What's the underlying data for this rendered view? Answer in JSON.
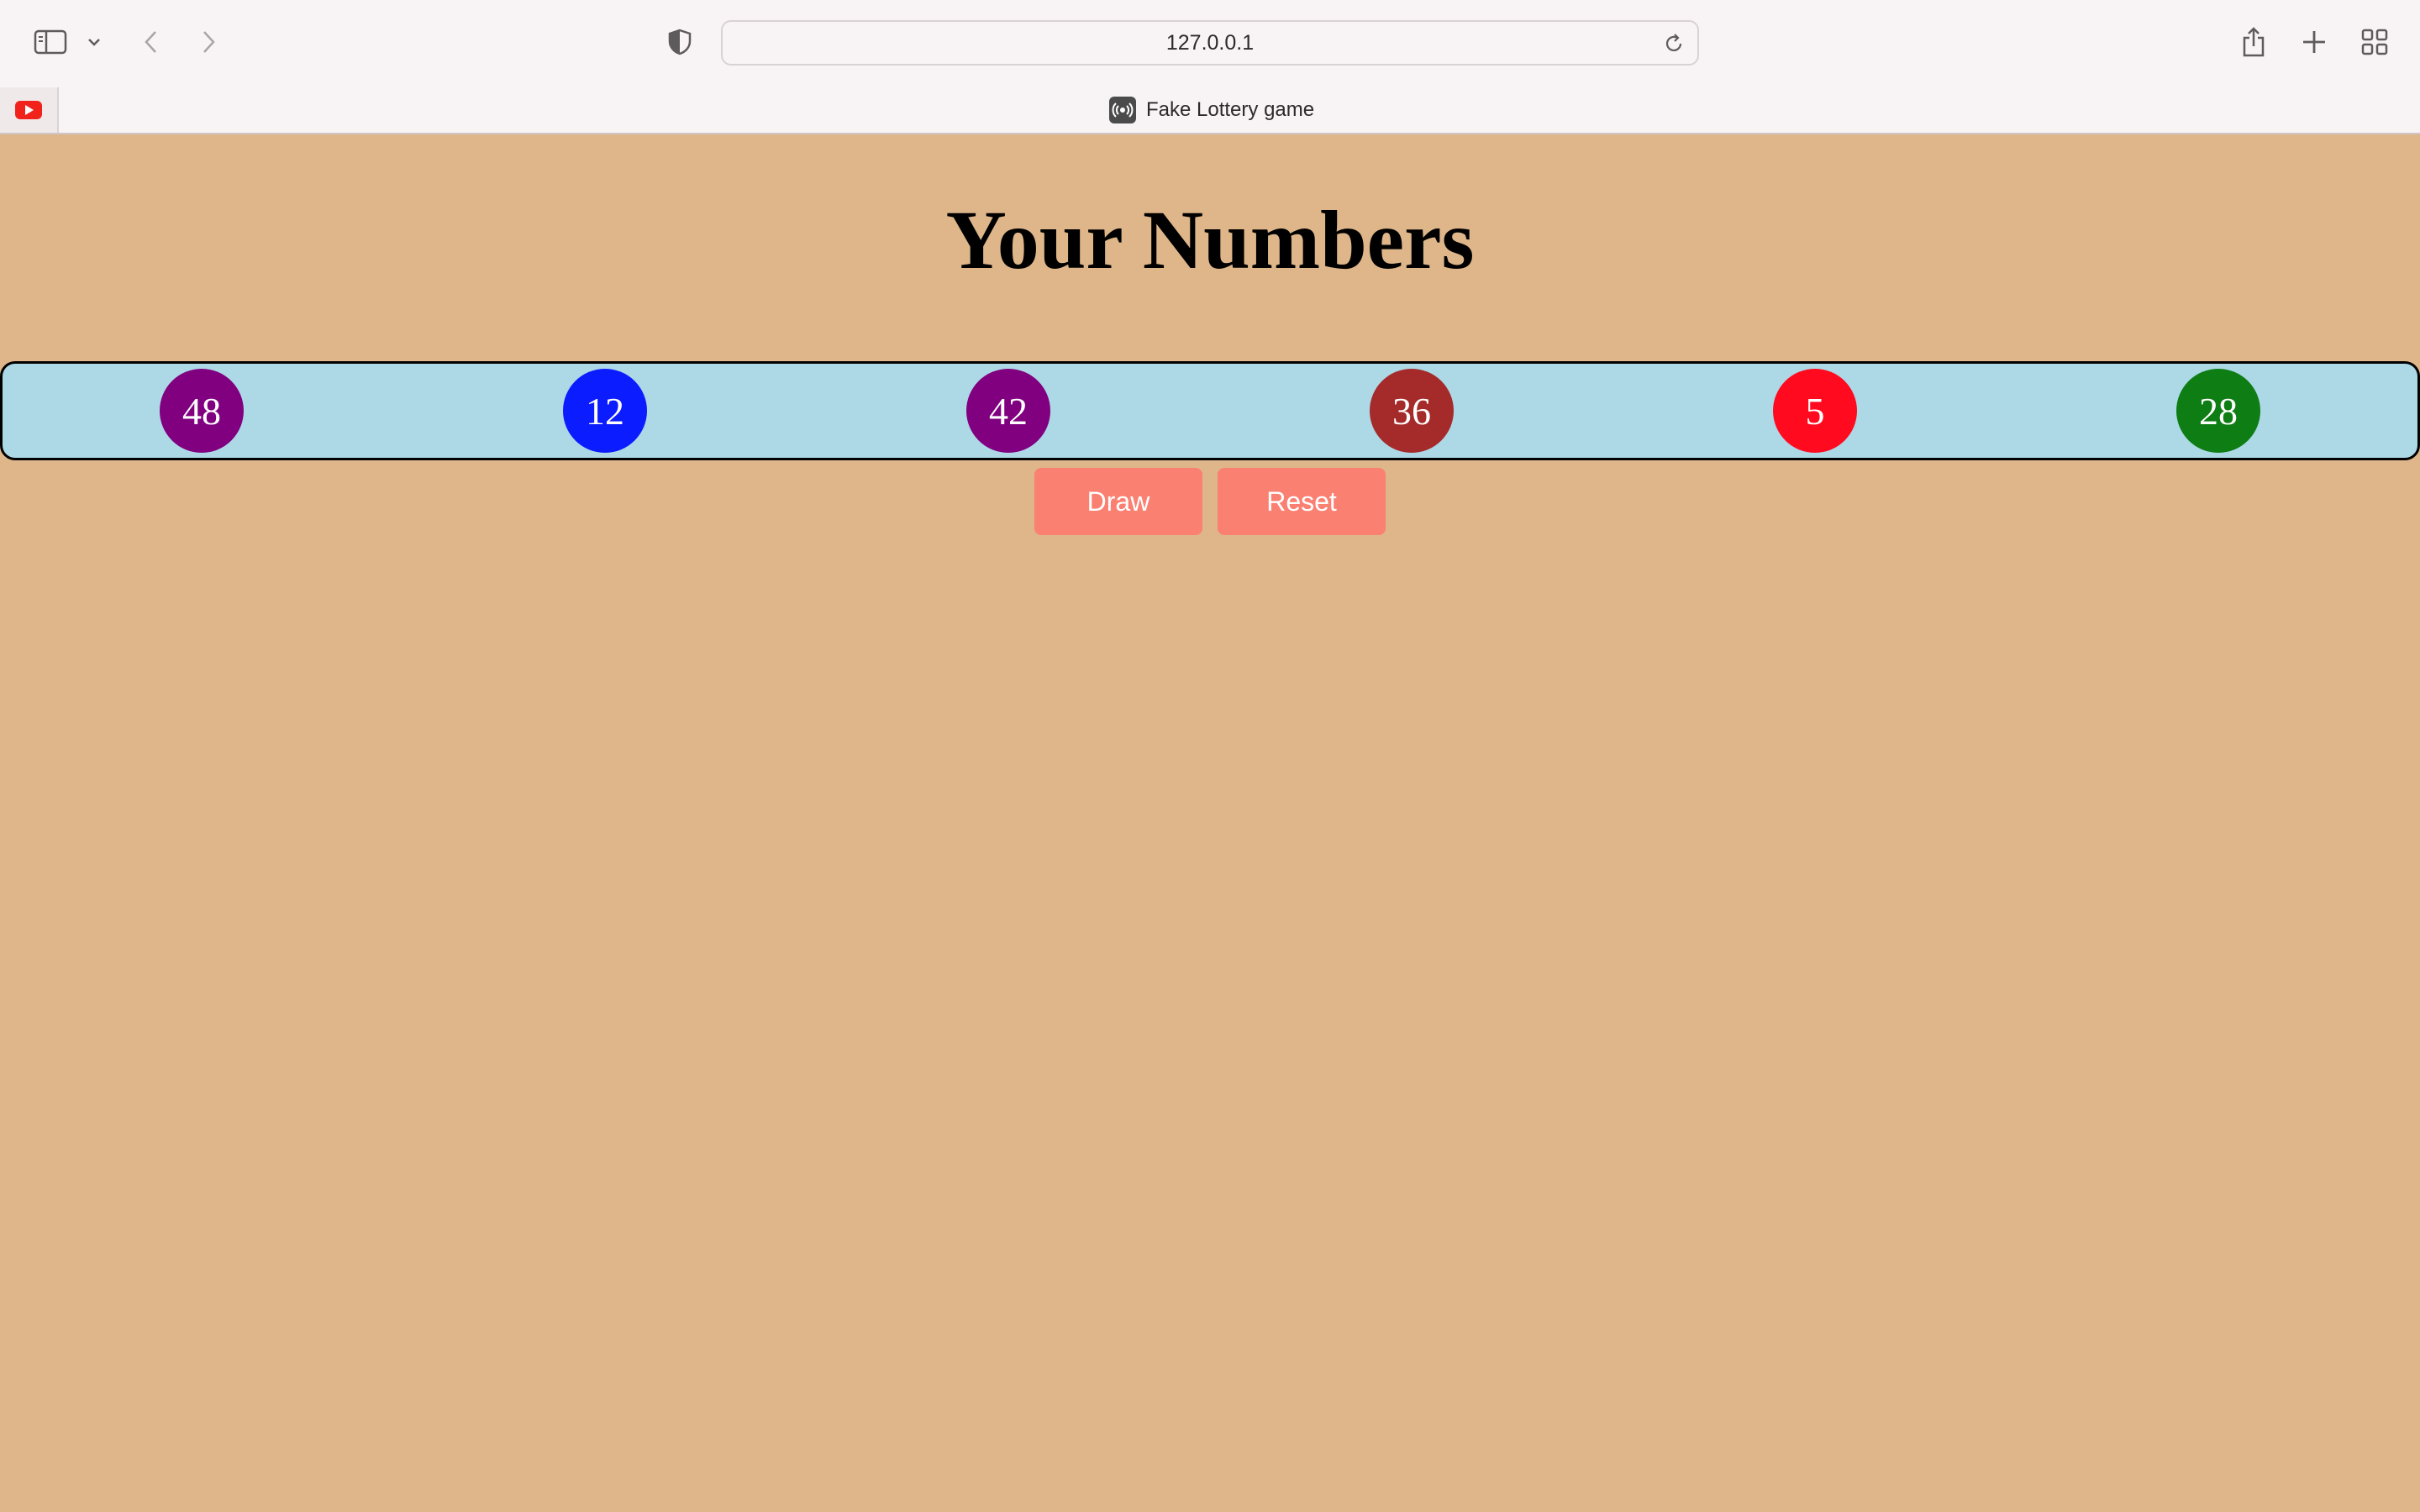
{
  "browser": {
    "url": "127.0.0.1",
    "active_tab_title": "Fake Lottery game",
    "icons": {
      "sidebar": "sidebar-icon",
      "tab_group_menu": "chevron-down-icon",
      "back": "chevron-left-icon",
      "forward": "chevron-right-icon",
      "privacy": "shield-icon",
      "reload": "reload-icon",
      "share": "share-icon",
      "new_tab": "plus-icon",
      "tab_overview": "grid-icon",
      "pinned_tab": "youtube-icon",
      "favicon": "broadcast-icon"
    }
  },
  "page": {
    "heading": "Your Numbers",
    "numbers": [
      {
        "value": "48",
        "color": "#800080"
      },
      {
        "value": "12",
        "color": "#0b1cff"
      },
      {
        "value": "42",
        "color": "#800080"
      },
      {
        "value": "36",
        "color": "#a52a2a"
      },
      {
        "value": "5",
        "color": "#ff0a1e"
      },
      {
        "value": "28",
        "color": "#0e7d14"
      }
    ],
    "buttons": {
      "draw_label": "Draw",
      "reset_label": "Reset"
    },
    "colors": {
      "background": "#deb68a",
      "numbers_bar": "#add8e6",
      "button": "#fa8072"
    }
  }
}
